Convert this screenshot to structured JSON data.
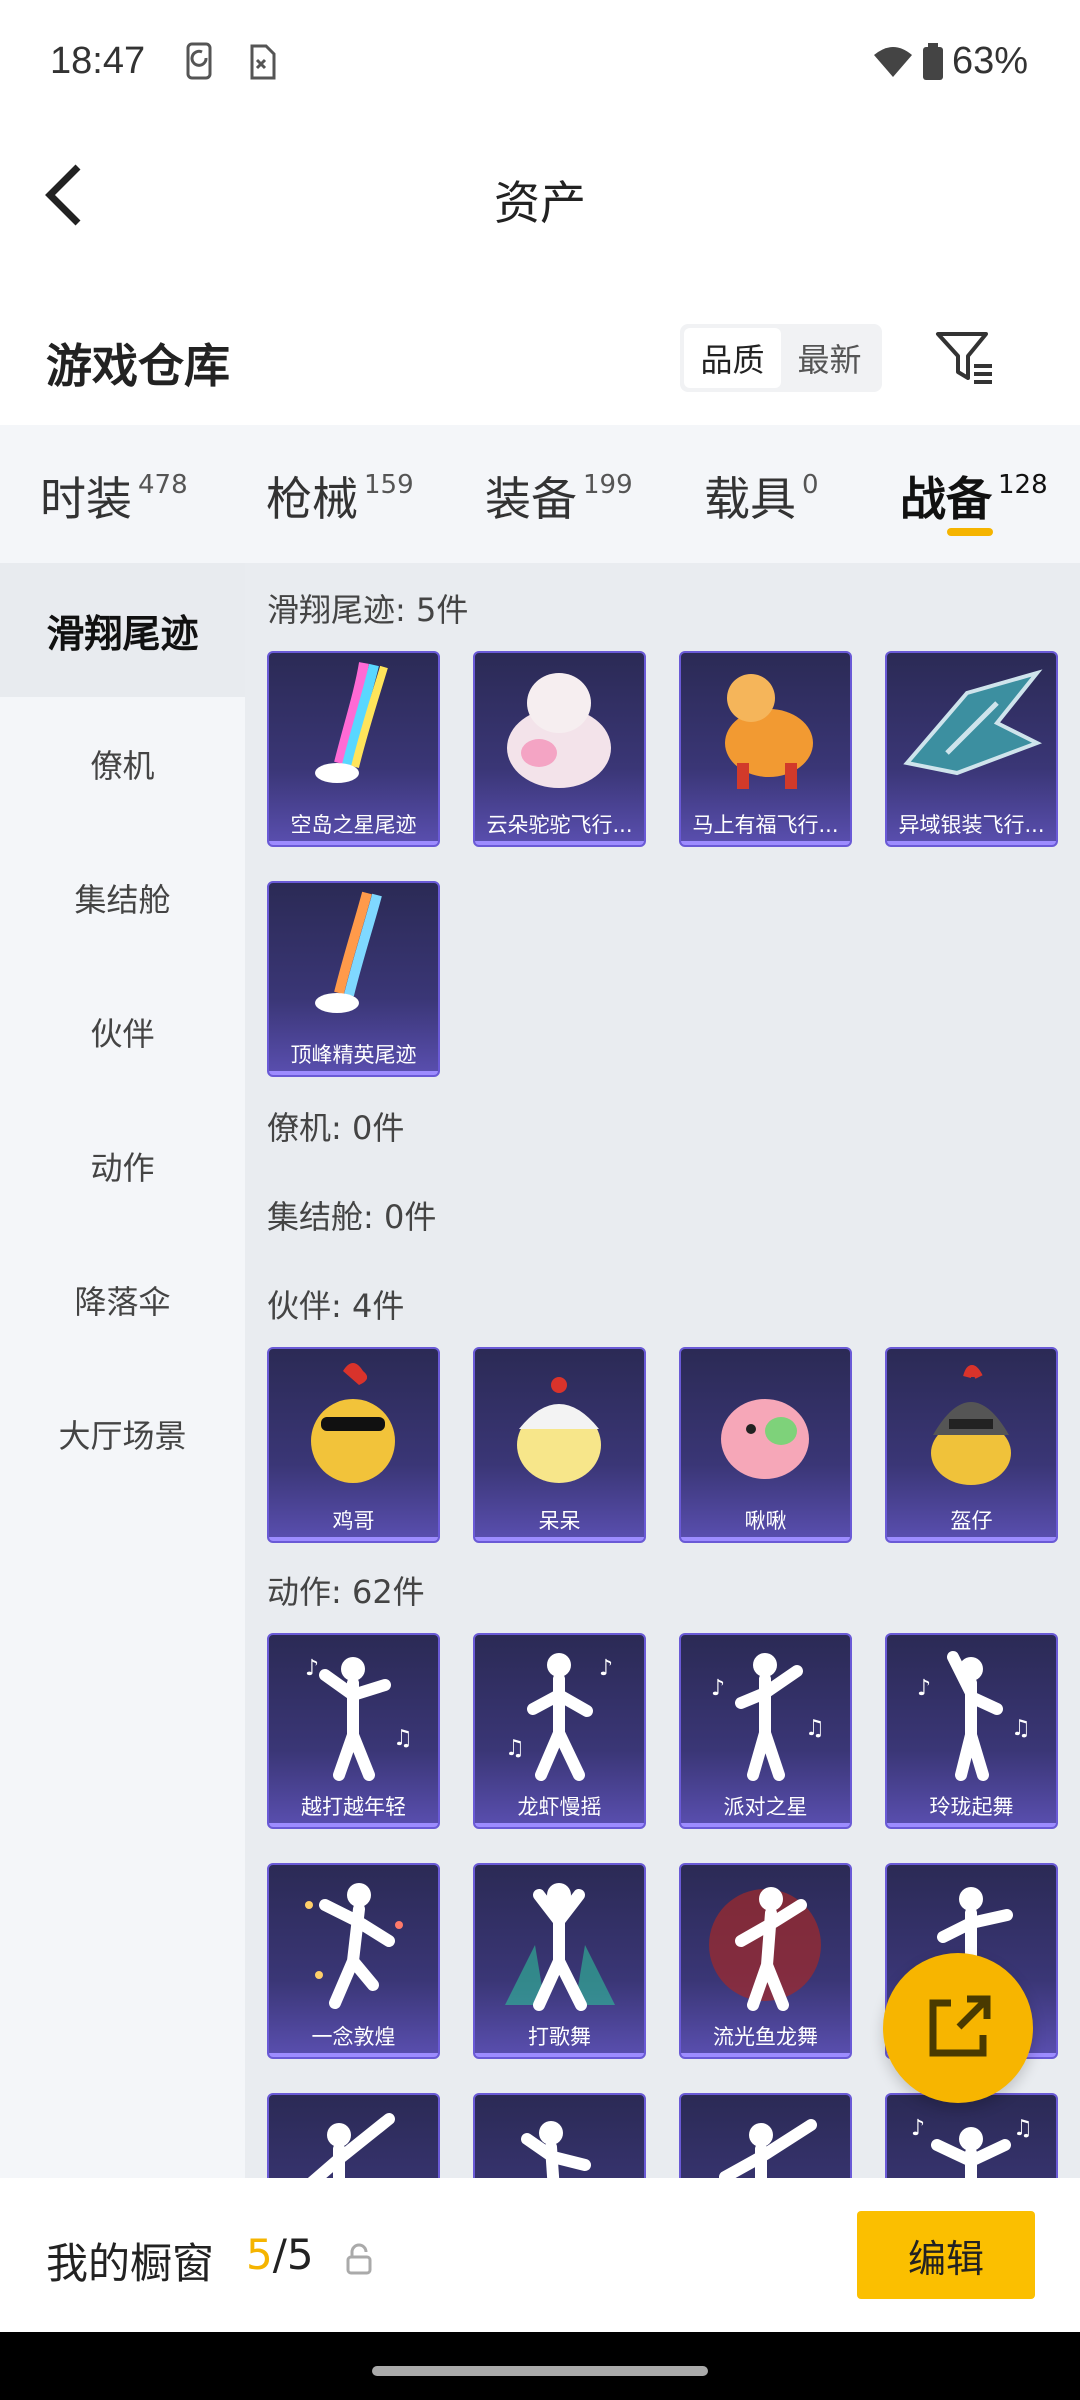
{
  "status_bar": {
    "time": "18:47",
    "battery": "63%"
  },
  "header": {
    "title": "资产"
  },
  "warehouse": {
    "title": "游戏仓库",
    "sort_options": [
      "品质",
      "最新"
    ]
  },
  "tabs": [
    {
      "label": "时装",
      "count": "478"
    },
    {
      "label": "枪械",
      "count": "159"
    },
    {
      "label": "装备",
      "count": "199"
    },
    {
      "label": "载具",
      "count": "0"
    },
    {
      "label": "战备",
      "count": "128"
    }
  ],
  "sidebar": [
    "滑翔尾迹",
    "僚机",
    "集结舱",
    "伙伴",
    "动作",
    "降落伞",
    "大厅场景"
  ],
  "sections": {
    "glide": {
      "title": "滑翔尾迹: 5件",
      "items": [
        "空岛之星尾迹",
        "云朵驼驼飞行...",
        "马上有福飞行...",
        "异域银装飞行...",
        "顶峰精英尾迹"
      ]
    },
    "wingman": {
      "title": "僚机: 0件"
    },
    "capsule": {
      "title": "集结舱: 0件"
    },
    "partner": {
      "title": "伙伴: 4件",
      "items": [
        "鸡哥",
        "呆呆",
        "啾啾",
        "盔仔"
      ]
    },
    "emote": {
      "title": "动作: 62件",
      "items": [
        "越打越年轻",
        "龙虾慢摇",
        "派对之星",
        "玲珑起舞",
        "一念敦煌",
        "打歌舞",
        "流光鱼龙舞"
      ]
    }
  },
  "bottom": {
    "title": "我的橱窗",
    "current": "5",
    "total": "/5",
    "edit_label": "编辑"
  },
  "colors": {
    "accent": "#f5b400",
    "card_purple": "#3a3676"
  }
}
